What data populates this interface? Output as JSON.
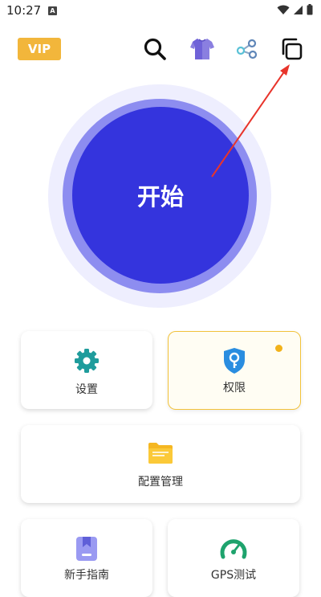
{
  "status_bar": {
    "time": "10:27",
    "notification_glyph": "A",
    "icons": [
      "wifi-icon",
      "signal-icon",
      "battery-icon"
    ]
  },
  "toolbar": {
    "vip_label": "VIP",
    "icons": [
      "search-icon",
      "tshirt-icon",
      "share-icon",
      "copy-icon"
    ]
  },
  "main": {
    "start_label": "开始"
  },
  "cards": {
    "settings": {
      "label": "设置",
      "icon": "gear-icon"
    },
    "permissions": {
      "label": "权限",
      "icon": "key-shield-icon",
      "badge": true
    },
    "config": {
      "label": "配置管理",
      "icon": "folder-icon"
    },
    "guide": {
      "label": "新手指南",
      "icon": "bookmark-icon"
    },
    "gps": {
      "label": "GPS测试",
      "icon": "gauge-icon"
    }
  },
  "colors": {
    "accent": "#3434dd",
    "vip": "#f2b63b",
    "settings_icon": "#1f9c9c",
    "permissions_icon": "#2a8de0",
    "folder": "#f5b722",
    "guide_icon": "#8e8ef0",
    "gps_icon": "#1ea36d",
    "annotation": "#e8342b"
  }
}
